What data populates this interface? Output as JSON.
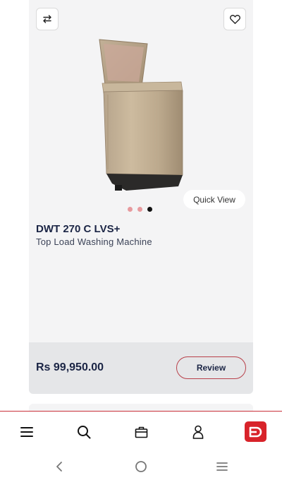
{
  "product": {
    "name": "DWT 270 C LVS+",
    "type": "Top Load Washing Machine",
    "price": "Rs 99,950.00",
    "image_slides": 3,
    "active_slide": 3
  },
  "actions": {
    "quick_view_label": "Quick View",
    "review_label": "Review"
  },
  "icons": {
    "compare": "compare-arrows-icon",
    "wishlist": "heart-icon",
    "menu": "menu-icon",
    "search": "search-icon",
    "bag": "shopping-bag-icon",
    "account": "user-icon",
    "brand": "brand-logo-icon",
    "back": "back-icon",
    "home": "home-icon",
    "recents": "recents-icon"
  },
  "colors": {
    "accent": "#d8232a",
    "text_primary": "#1b2545",
    "card_bg": "#f4f4f5",
    "price_bar_bg": "#e5e6e8"
  }
}
